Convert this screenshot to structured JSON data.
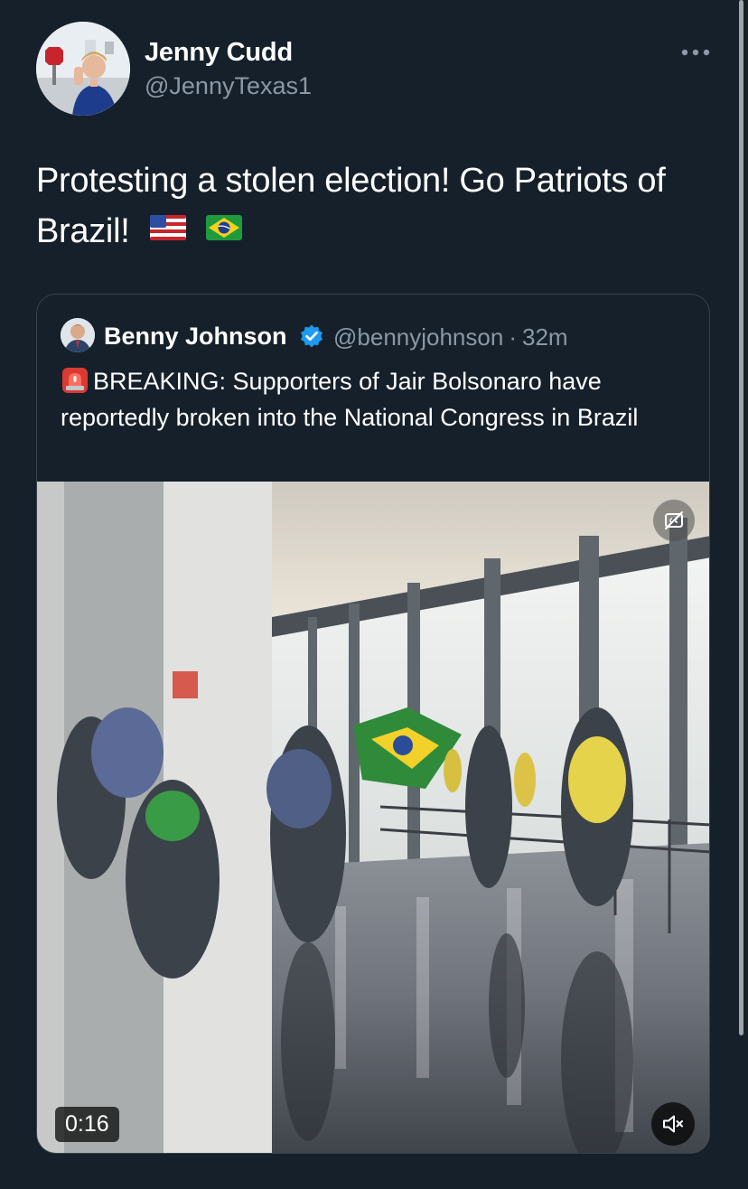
{
  "author": {
    "display_name": "Jenny Cudd",
    "handle": "@JennyTexas1",
    "avatar_icon": "profile-photo"
  },
  "tweet": {
    "text": "Protesting a stolen election! Go Patriots of Brazil!",
    "flags": [
      "us-flag-emoji",
      "brazil-flag-emoji"
    ]
  },
  "more_icon": "ellipsis-icon",
  "quote": {
    "display_name": "Benny Johnson",
    "verified": true,
    "handle": "@bennyjohnson",
    "separator": "·",
    "time": "32m",
    "text": "BREAKING: Supporters of Jair Bolsonaro have reportedly broken into the National Congress in Brazil",
    "text_icon": "siren-emoji"
  },
  "video": {
    "duration": "0:16",
    "cc_icon": "captions-off-icon",
    "mute_icon": "volume-muted-icon"
  },
  "colors": {
    "background": "#15202b",
    "text_primary": "#ffffff",
    "text_secondary": "#8b98a5",
    "border": "#38444d",
    "verified": "#1d9bf0"
  }
}
